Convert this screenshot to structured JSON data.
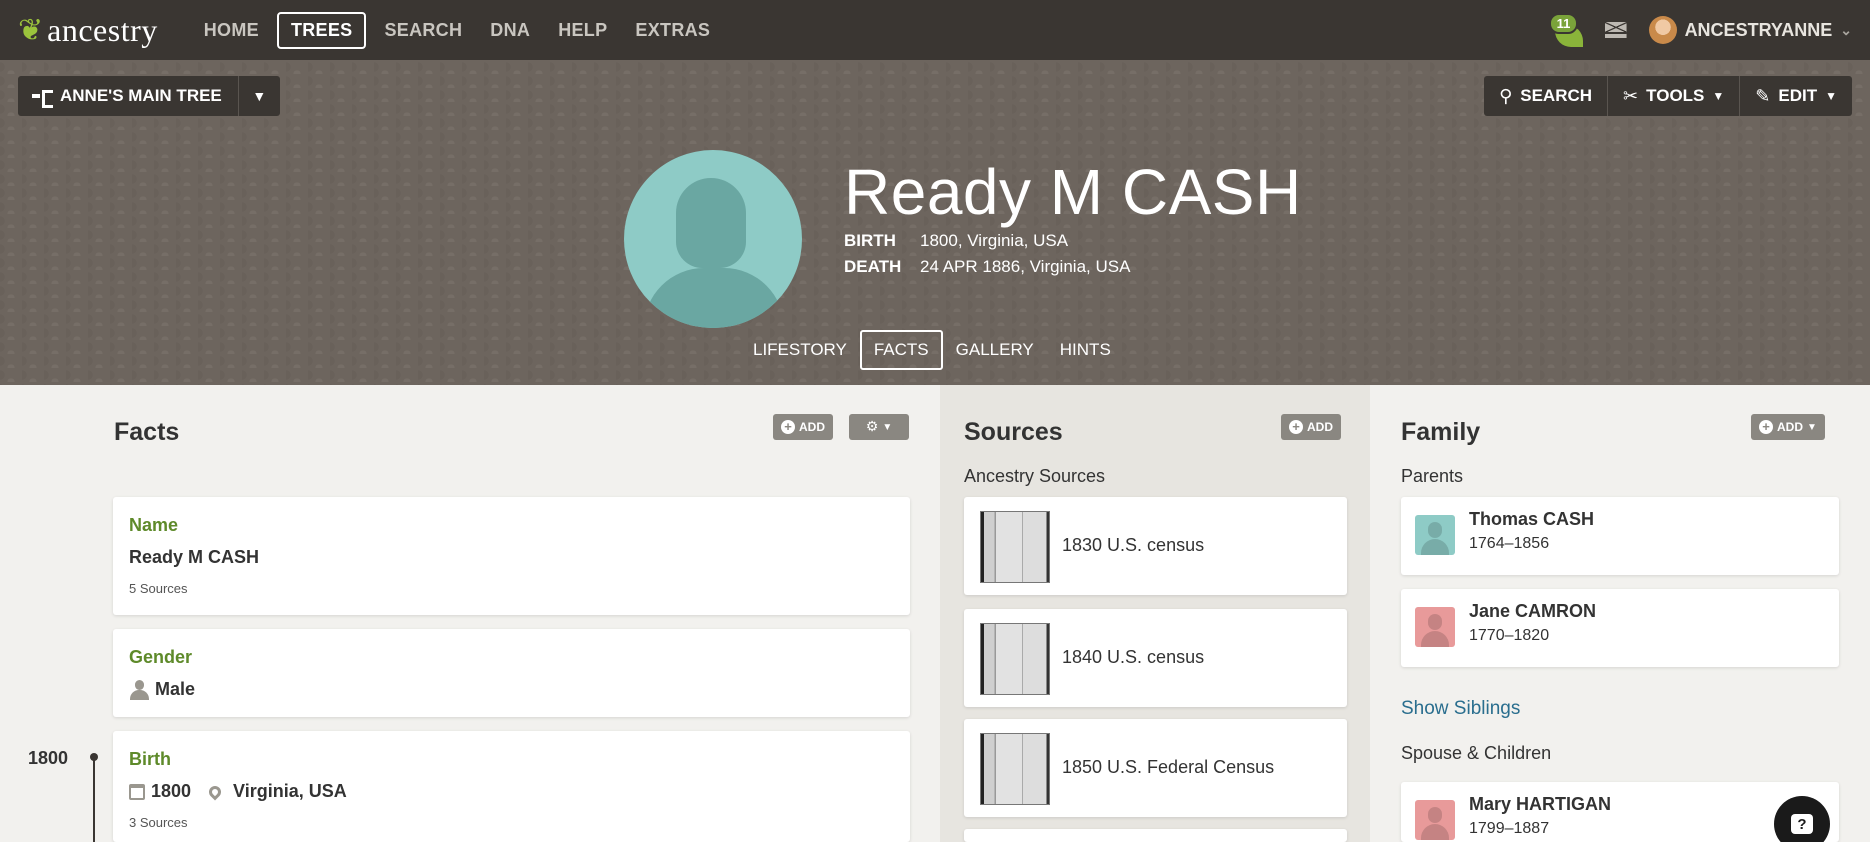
{
  "nav": {
    "logo_text": "ancestry",
    "links": [
      "HOME",
      "TREES",
      "SEARCH",
      "DNA",
      "HELP",
      "EXTRAS"
    ],
    "notification_count": "11",
    "username": "ANCESTRYANNE",
    "accent_color": "#9bc43c",
    "bar_color": "#3a3632"
  },
  "tree": {
    "name": "ANNE'S MAIN TREE"
  },
  "toolbar": {
    "search": "SEARCH",
    "tools": "TOOLS",
    "edit": "EDIT"
  },
  "person": {
    "name": "Ready M CASH",
    "birth_label": "BIRTH",
    "birth_value": "1800, Virginia, USA",
    "death_label": "DEATH",
    "death_value": "24 APR 1886, Virginia, USA"
  },
  "tabs": [
    "LIFESTORY",
    "FACTS",
    "GALLERY",
    "HINTS"
  ],
  "facts": {
    "title": "Facts",
    "add_label": "ADD",
    "items": [
      {
        "label": "Name",
        "value": "Ready M CASH",
        "sources": "5 Sources"
      },
      {
        "label": "Gender",
        "value": "Male"
      },
      {
        "label": "Birth",
        "date": "1800",
        "place": "Virginia, USA",
        "sources": "3 Sources"
      }
    ],
    "timeline_year": "1800"
  },
  "sources": {
    "title": "Sources",
    "add_label": "ADD",
    "subtitle": "Ancestry Sources",
    "items": [
      "1830 U.S. census",
      "1840 U.S. census",
      "1850 U.S. Federal Census"
    ]
  },
  "family": {
    "title": "Family",
    "add_label": "ADD",
    "parents_label": "Parents",
    "parents": [
      {
        "name": "Thomas CASH",
        "dates": "1764–1856",
        "gender": "male"
      },
      {
        "name": "Jane CAMRON",
        "dates": "1770–1820",
        "gender": "female"
      }
    ],
    "show_siblings": "Show Siblings",
    "spouse_label": "Spouse & Children",
    "spouses": [
      {
        "name": "Mary HARTIGAN",
        "dates": "1799–1887",
        "gender": "female"
      }
    ]
  },
  "help": {
    "label": "?"
  }
}
